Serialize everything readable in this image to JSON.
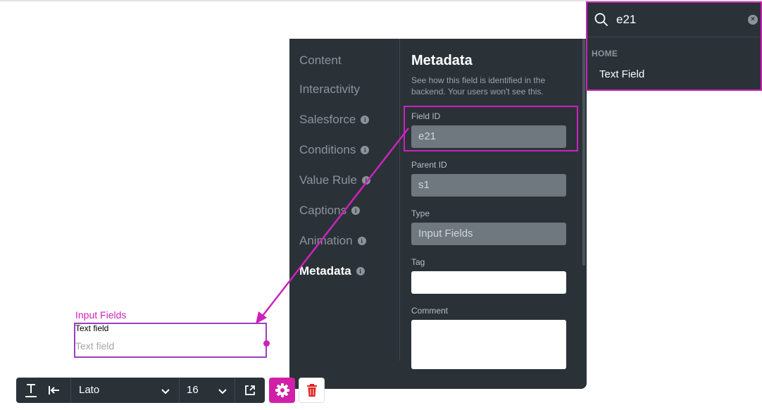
{
  "panel": {
    "nav": [
      {
        "label": "Content",
        "info": false,
        "active": false
      },
      {
        "label": "Interactivity",
        "info": false,
        "active": false
      },
      {
        "label": "Salesforce",
        "info": true,
        "active": false
      },
      {
        "label": "Conditions",
        "info": true,
        "active": false
      },
      {
        "label": "Value Rule",
        "info": true,
        "active": false
      },
      {
        "label": "Captions",
        "info": true,
        "active": false
      },
      {
        "label": "Animation",
        "info": true,
        "active": false
      },
      {
        "label": "Metadata",
        "info": true,
        "active": true
      }
    ],
    "title": "Metadata",
    "description": "See how this field is identified in the backend. Your users won't see this.",
    "fields": {
      "field_id": {
        "label": "Field ID",
        "value": "e21"
      },
      "parent_id": {
        "label": "Parent ID",
        "value": "s1"
      },
      "type": {
        "label": "Type",
        "value": "Input Fields"
      },
      "tag": {
        "label": "Tag",
        "value": ""
      },
      "comment": {
        "label": "Comment",
        "value": ""
      }
    }
  },
  "search": {
    "query": "e21",
    "section": "HOME",
    "result": "Text Field"
  },
  "canvas": {
    "group_label": "Input Fields",
    "field_label": "Text field",
    "placeholder": "Text field"
  },
  "toolbar": {
    "font": "Lato",
    "size": "16"
  },
  "colors": {
    "accent": "#cc22bb",
    "panel_bg": "#2a3238",
    "input_bg": "#6e787e",
    "delete": "#e02020"
  }
}
